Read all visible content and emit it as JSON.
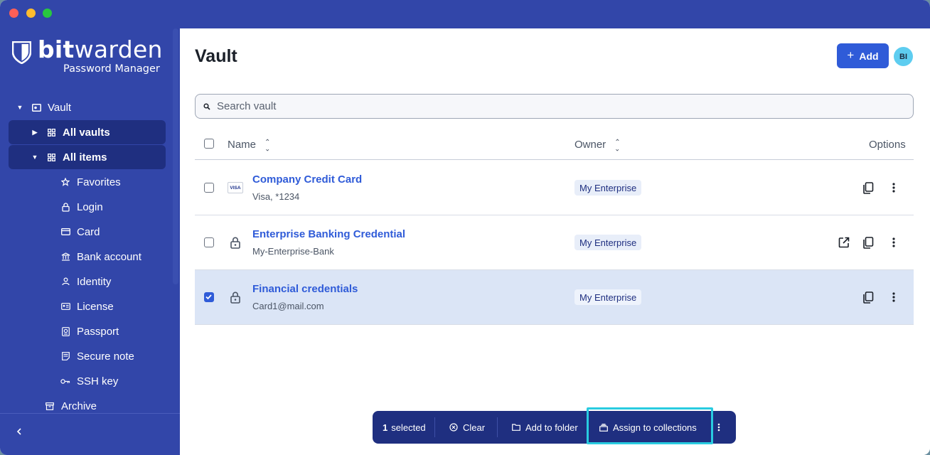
{
  "app": {
    "logo_bold": "bit",
    "logo_light": "warden",
    "logo_sub": "Password Manager"
  },
  "sidebar": {
    "vault_label": "Vault",
    "all_vaults": "All vaults",
    "all_items": "All items",
    "items": [
      {
        "label": "Favorites",
        "icon": "star-icon"
      },
      {
        "label": "Login",
        "icon": "lock-icon"
      },
      {
        "label": "Card",
        "icon": "card-icon"
      },
      {
        "label": "Bank account",
        "icon": "bank-icon"
      },
      {
        "label": "Identity",
        "icon": "person-icon"
      },
      {
        "label": "License",
        "icon": "id-card-icon"
      },
      {
        "label": "Passport",
        "icon": "passport-icon"
      },
      {
        "label": "Secure note",
        "icon": "note-icon"
      },
      {
        "label": "SSH key",
        "icon": "key-icon"
      },
      {
        "label": "Archive",
        "icon": "archive-icon"
      }
    ]
  },
  "header": {
    "title": "Vault",
    "add_label": "Add",
    "avatar_initials": "BI"
  },
  "search": {
    "placeholder": "Search vault"
  },
  "table": {
    "col_name": "Name",
    "col_owner": "Owner",
    "col_options": "Options",
    "rows": [
      {
        "name": "Company Credit Card",
        "sub": "Visa, *1234",
        "owner": "My Enterprise",
        "icon": "visa-card-icon",
        "selected": false
      },
      {
        "name": "Enterprise Banking Credential",
        "sub": "My-Enterprise-Bank",
        "owner": "My Enterprise",
        "icon": "lock-icon",
        "selected": false
      },
      {
        "name": "Financial credentials",
        "sub": "Card1@mail.com",
        "owner": "My Enterprise",
        "icon": "lock-icon",
        "selected": true
      }
    ]
  },
  "bulk": {
    "count": "1",
    "selected_label": "selected",
    "clear_label": "Clear",
    "add_folder_label": "Add to folder",
    "assign_label": "Assign to collections"
  },
  "colors": {
    "sidebar": "#3246a9",
    "accent": "#2f5bd8",
    "bulk_bar": "#1f2f80",
    "highlight": "#29cbe0"
  }
}
